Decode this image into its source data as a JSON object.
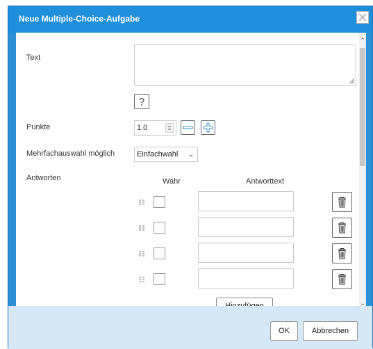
{
  "dialog": {
    "title": "Neue Multiple-Choice-Aufgabe",
    "close_icon": "close-icon",
    "accent_color": "#1f8fdc"
  },
  "form": {
    "text_label": "Text",
    "text_value": "",
    "help_icon": "question-mark-icon",
    "points_label": "Punkte",
    "points_value": "1.0",
    "decrement_icon": "minus-icon",
    "increment_icon": "plus-icon",
    "multi_label": "Mehrfachauswahl möglich",
    "multi_selected": "Einfachwahl"
  },
  "answers": {
    "label": "Antworten",
    "col_true": "Wahr",
    "col_text": "Antworttext",
    "rows": [
      {
        "checked": false,
        "text": ""
      },
      {
        "checked": false,
        "text": ""
      },
      {
        "checked": false,
        "text": ""
      },
      {
        "checked": false,
        "text": ""
      }
    ],
    "add_label": "Hinzufügen",
    "drag_icon": "drag-handle-icon",
    "delete_icon": "trash-icon"
  },
  "footer": {
    "ok_label": "OK",
    "cancel_label": "Abbrechen"
  }
}
